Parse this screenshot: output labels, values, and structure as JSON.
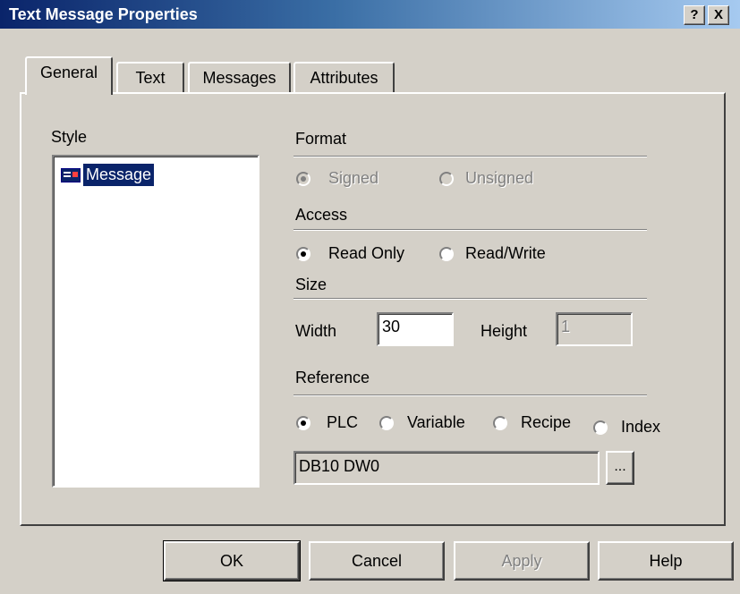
{
  "window": {
    "title": "Text Message Properties",
    "help_button": "?",
    "close_button": "X"
  },
  "tabs": [
    "General",
    "Text",
    "Messages",
    "Attributes"
  ],
  "style": {
    "label": "Style",
    "items": [
      "Message"
    ]
  },
  "format": {
    "label": "Format",
    "options": [
      "Signed",
      "Unsigned"
    ],
    "selected": "Signed",
    "enabled": false
  },
  "access": {
    "label": "Access",
    "options": [
      "Read Only",
      "Read/Write"
    ],
    "selected": "Read Only"
  },
  "size": {
    "label": "Size",
    "width_label": "Width",
    "width_value": "30",
    "height_label": "Height",
    "height_value": "1"
  },
  "reference": {
    "label": "Reference",
    "options": [
      "PLC",
      "Variable",
      "Recipe",
      "Index"
    ],
    "selected": "PLC",
    "address_value": "DB10 DW0",
    "browse_label": "..."
  },
  "buttons": {
    "ok": "OK",
    "cancel": "Cancel",
    "apply": "Apply",
    "help": "Help"
  },
  "icons": {
    "message_item": "message-list-icon"
  }
}
